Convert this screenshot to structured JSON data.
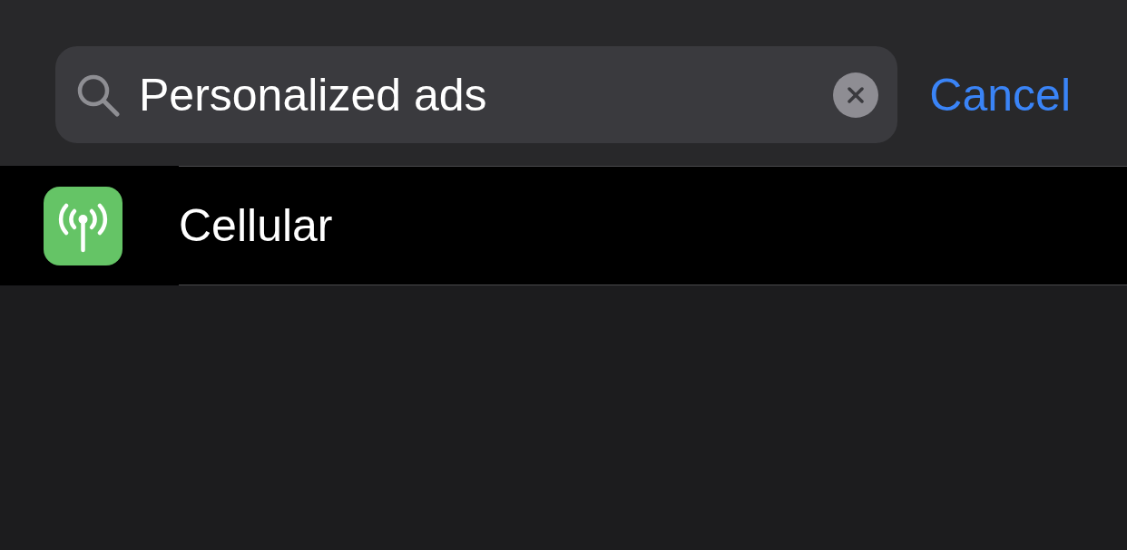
{
  "search": {
    "value": "Personalized ads"
  },
  "cancel": "Cancel",
  "results": [
    {
      "label": "Cellular"
    }
  ]
}
